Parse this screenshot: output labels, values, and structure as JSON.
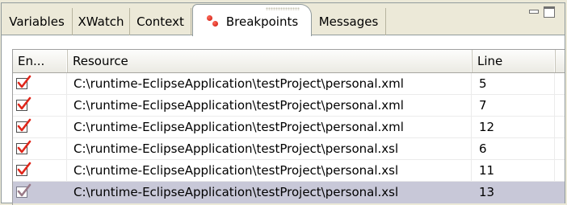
{
  "tabs": [
    {
      "label": "Variables"
    },
    {
      "label": "XWatch"
    },
    {
      "label": "Context"
    },
    {
      "label": "Breakpoints"
    },
    {
      "label": "Messages"
    }
  ],
  "active_tab": "Breakpoints",
  "icons": {
    "breakpoints_tab": "breakpoint-dots-icon",
    "minimize": "minimize-icon",
    "maximize": "maximize-icon",
    "enabled_check": "checkbox-checked-icon"
  },
  "colors": {
    "breakpoint": "#c8140a",
    "check": "#e0261a",
    "selected_row": "#c8c8d8"
  },
  "table": {
    "columns": [
      "En...",
      "Resource",
      "Line"
    ],
    "rows": [
      {
        "enabled": true,
        "resource": "C:\\runtime-EclipseApplication\\testProject\\personal.xml",
        "line": "5"
      },
      {
        "enabled": true,
        "resource": "C:\\runtime-EclipseApplication\\testProject\\personal.xml",
        "line": "7"
      },
      {
        "enabled": true,
        "resource": "C:\\runtime-EclipseApplication\\testProject\\personal.xml",
        "line": "12"
      },
      {
        "enabled": true,
        "resource": "C:\\runtime-EclipseApplication\\testProject\\personal.xsl",
        "line": "6"
      },
      {
        "enabled": true,
        "resource": "C:\\runtime-EclipseApplication\\testProject\\personal.xsl",
        "line": "11"
      },
      {
        "enabled": true,
        "resource": "C:\\runtime-EclipseApplication\\testProject\\personal.xsl",
        "line": "13",
        "selected": true
      }
    ]
  }
}
